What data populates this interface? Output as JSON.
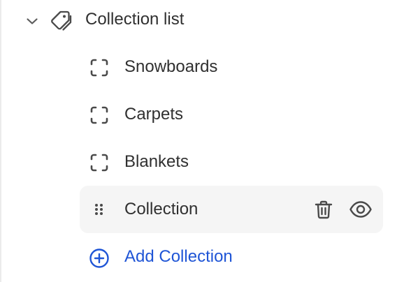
{
  "section": {
    "title": "Collection list",
    "items": [
      {
        "label": "Snowboards"
      },
      {
        "label": "Carpets"
      },
      {
        "label": "Blankets"
      },
      {
        "label": "Collection"
      }
    ],
    "add_label": "Add Collection"
  },
  "colors": {
    "text": "#303030",
    "link": "#1f55d6",
    "selected_background": "#f5f5f5",
    "divider": "#ebebeb"
  },
  "icons": {
    "expand": "chevron-down-icon",
    "section": "tag-icon",
    "item": "dashed-square-icon",
    "drag": "drag-handle-icon",
    "delete": "trash-icon",
    "visibility": "eye-icon",
    "add": "plus-circle-icon"
  }
}
